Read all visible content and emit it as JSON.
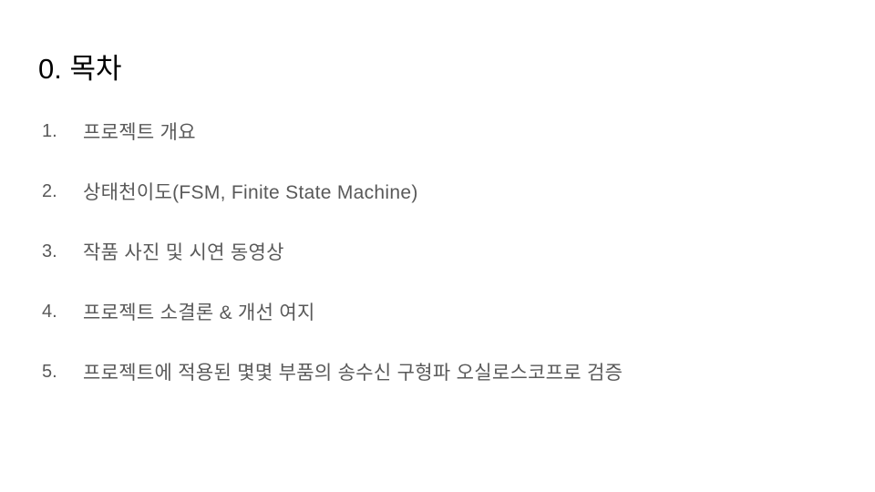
{
  "slide": {
    "title": "0. 목차",
    "items": [
      {
        "number": "1.",
        "text": "프로젝트 개요"
      },
      {
        "number": "2.",
        "text": "상태천이도(FSM, Finite State Machine)"
      },
      {
        "number": "3.",
        "text": "작품 사진 및 시연 동영상"
      },
      {
        "number": "4.",
        "text": "프로젝트 소결론 & 개선 여지"
      },
      {
        "number": "5.",
        "text": "프로젝트에 적용된 몇몇 부품의 송수신 구형파 오실로스코프로 검증"
      }
    ]
  },
  "colors": {
    "title": "#000000",
    "body": "#595959",
    "background": "#ffffff"
  }
}
